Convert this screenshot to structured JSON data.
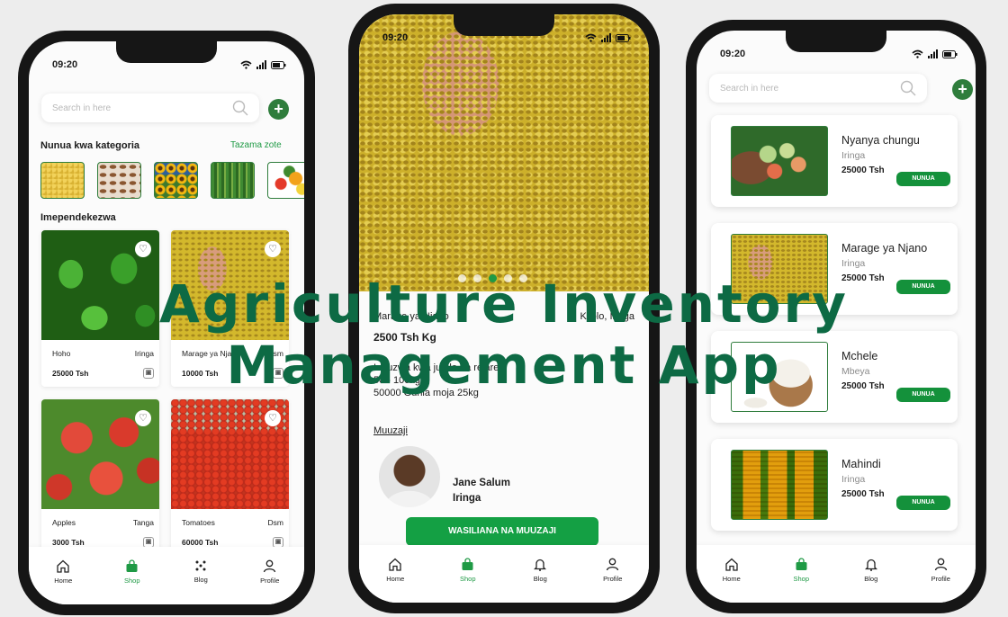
{
  "status_time": "09:20",
  "colors": {
    "brand_green": "#2f7d3c",
    "button_green": "#14913b",
    "title_green": "#0d6a44"
  },
  "overlay_title": {
    "line1": "Agriculture Inventory",
    "line2": "Management App"
  },
  "tabbar": [
    {
      "label": "Home",
      "icon": "home-icon"
    },
    {
      "label": "Shop",
      "icon": "shop-icon"
    },
    {
      "label": "Blog",
      "icon": "blog-icon"
    },
    {
      "label": "Profile",
      "icon": "profile-icon"
    }
  ],
  "phone1": {
    "search_placeholder": "Search in here",
    "categories_heading": "Nunua kwa kategoria",
    "see_all": "Tazama zote",
    "categories": [
      "maize",
      "cashew",
      "sunflower",
      "millet",
      "fruits"
    ],
    "recommended_heading": "Imependekezwa",
    "products": [
      {
        "name": "Hoho",
        "location": "Iringa",
        "price": "25000 Tsh"
      },
      {
        "name": "Marage ya Njano",
        "location": "Dsm",
        "price": "10000 Tsh"
      },
      {
        "name": "Apples",
        "location": "Tanga",
        "price": "3000 Tsh"
      },
      {
        "name": "Tomatoes",
        "location": "Dsm",
        "price": "60000 Tsh"
      }
    ]
  },
  "phone2": {
    "carousel_active": 3,
    "detail_line1_left": "Marage ya Njano",
    "detail_line1_right": "Kilolo, Iringa",
    "price_per_unit": "2500 Tsh Kg",
    "desc_line1": "Inauzwa kwa jumla na rejareja",
    "desc_line2": "50 - 100kg",
    "desc_line3": "50000 Gunia moja 25kg",
    "seller_heading": "Muuzaji",
    "seller_name": "Jane Salum",
    "seller_location": "Iringa",
    "contact_button": "WASILIANA NA MUUZAJI"
  },
  "phone3": {
    "search_placeholder": "Search in here",
    "buy_label": "NUNUA",
    "items": [
      {
        "name": "Nyanya chungu",
        "location": "Iringa",
        "price": "25000 Tsh"
      },
      {
        "name": "Marage ya Njano",
        "location": "Iringa",
        "price": "25000 Tsh"
      },
      {
        "name": "Mchele",
        "location": "Mbeya",
        "price": "25000 Tsh"
      },
      {
        "name": "Mahindi",
        "location": "Iringa",
        "price": "25000 Tsh"
      }
    ]
  }
}
